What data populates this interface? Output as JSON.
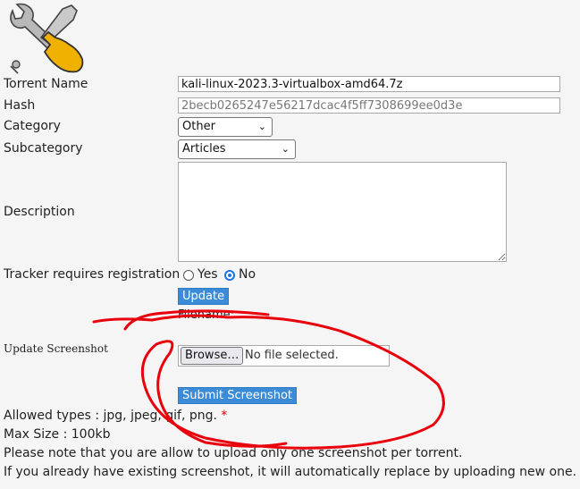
{
  "form": {
    "torrent_name_label": "Torrent Name",
    "torrent_name_value": "kali-linux-2023.3-virtualbox-amd64.7z",
    "hash_label": "Hash",
    "hash_value": "2becb0265247e56217dcac4f5ff7308699ee0d3e",
    "category_label": "Category",
    "category_value": "Other",
    "subcategory_label": "Subcategory",
    "subcategory_value": "Articles",
    "description_label": "Description",
    "description_value": "",
    "tracker_label": "Tracker requires registration",
    "tracker_yes": "Yes",
    "tracker_no": "No",
    "tracker_selected": "No",
    "update_button": "Update"
  },
  "screenshot": {
    "label": "Update Screenshot",
    "filename_label": "Filename:",
    "browse_button": "Browse…",
    "no_file_text": "No file selected.",
    "submit_button": "Submit Screenshot"
  },
  "notes": {
    "allowed_types": "Allowed types : jpg, jpeg, gif, png.",
    "required_marker": "*",
    "max_size": "Max Size : 100kb",
    "line1": "Please note that you are allow to upload only one screenshot per torrent.",
    "line2": "If you already have existing screenshot, it will automatically replace by uploading new one."
  },
  "icons": {
    "tools": "tools-icon",
    "chevron": "chevron-down-icon"
  },
  "colors": {
    "button_blue": "#3b8bd6",
    "annotation_red": "#e8000b",
    "radio_selected": "#1a73e8"
  }
}
